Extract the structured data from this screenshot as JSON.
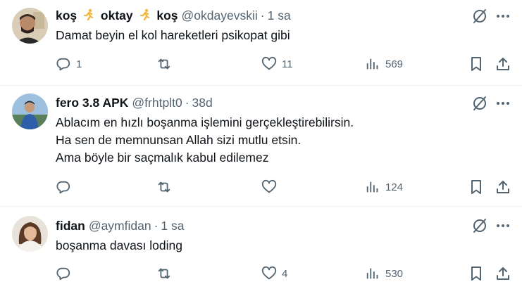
{
  "tweets": [
    {
      "name": "koş 🏃‍♀️ oktay 🏃‍♀️ koş",
      "name_parts": [
        "koş",
        "oktay",
        "koş"
      ],
      "handle": "@okdayevskii",
      "separator": "·",
      "time": "1 sa",
      "lines": [
        "Damat beyin el kol hareketleri psikopat gibi"
      ],
      "replies": "1",
      "retweets": "",
      "likes": "11",
      "views": "569"
    },
    {
      "name": "fero 3.8 APK",
      "handle": "@frhtplt0",
      "separator": "·",
      "time": "38d",
      "lines": [
        "Ablacım en hızlı boşanma işlemini gerçekleştirebilirsin.",
        "Ha sen de memnunsan Allah sizi mutlu etsin.",
        "Ama böyle bir saçmalık kabul edilemez"
      ],
      "replies": "",
      "retweets": "",
      "likes": "",
      "views": "124"
    },
    {
      "name": "fidan",
      "handle": "@aymfidan",
      "separator": "·",
      "time": "1 sa",
      "lines": [
        "boşanma davası loding"
      ],
      "replies": "",
      "retweets": "",
      "likes": "4",
      "views": "530"
    }
  ],
  "icons": {
    "reply": "reply-icon",
    "retweet": "retweet-icon",
    "like": "heart-icon",
    "views": "views-chart-icon",
    "bookmark": "bookmark-icon",
    "share": "share-icon",
    "grok": "grok-icon",
    "more": "more-icon"
  },
  "colors": {
    "text": "#0f1419",
    "secondary": "#536471",
    "divider": "#eff3f4",
    "runner_emoji": "#f4b43a"
  }
}
